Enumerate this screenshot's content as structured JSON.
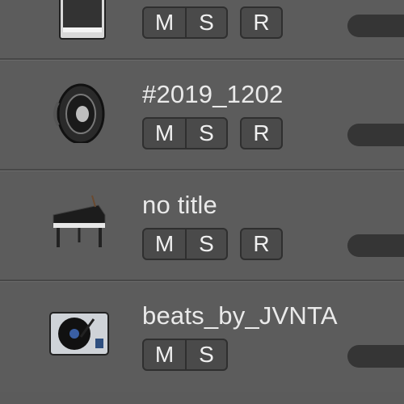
{
  "tracks": [
    {
      "icon": "grand-piano-icon",
      "name": "",
      "buttons": [
        "M",
        "S"
      ],
      "record": "R"
    },
    {
      "icon": "speaker-icon",
      "name": "#2019_1202",
      "buttons": [
        "M",
        "S"
      ],
      "record": "R"
    },
    {
      "icon": "piano-icon",
      "name": "no title",
      "buttons": [
        "M",
        "S"
      ],
      "record": "R"
    },
    {
      "icon": "turntable-icon",
      "name": "beats_by_JVNTA",
      "buttons": [
        "M",
        "S"
      ],
      "record": ""
    }
  ]
}
